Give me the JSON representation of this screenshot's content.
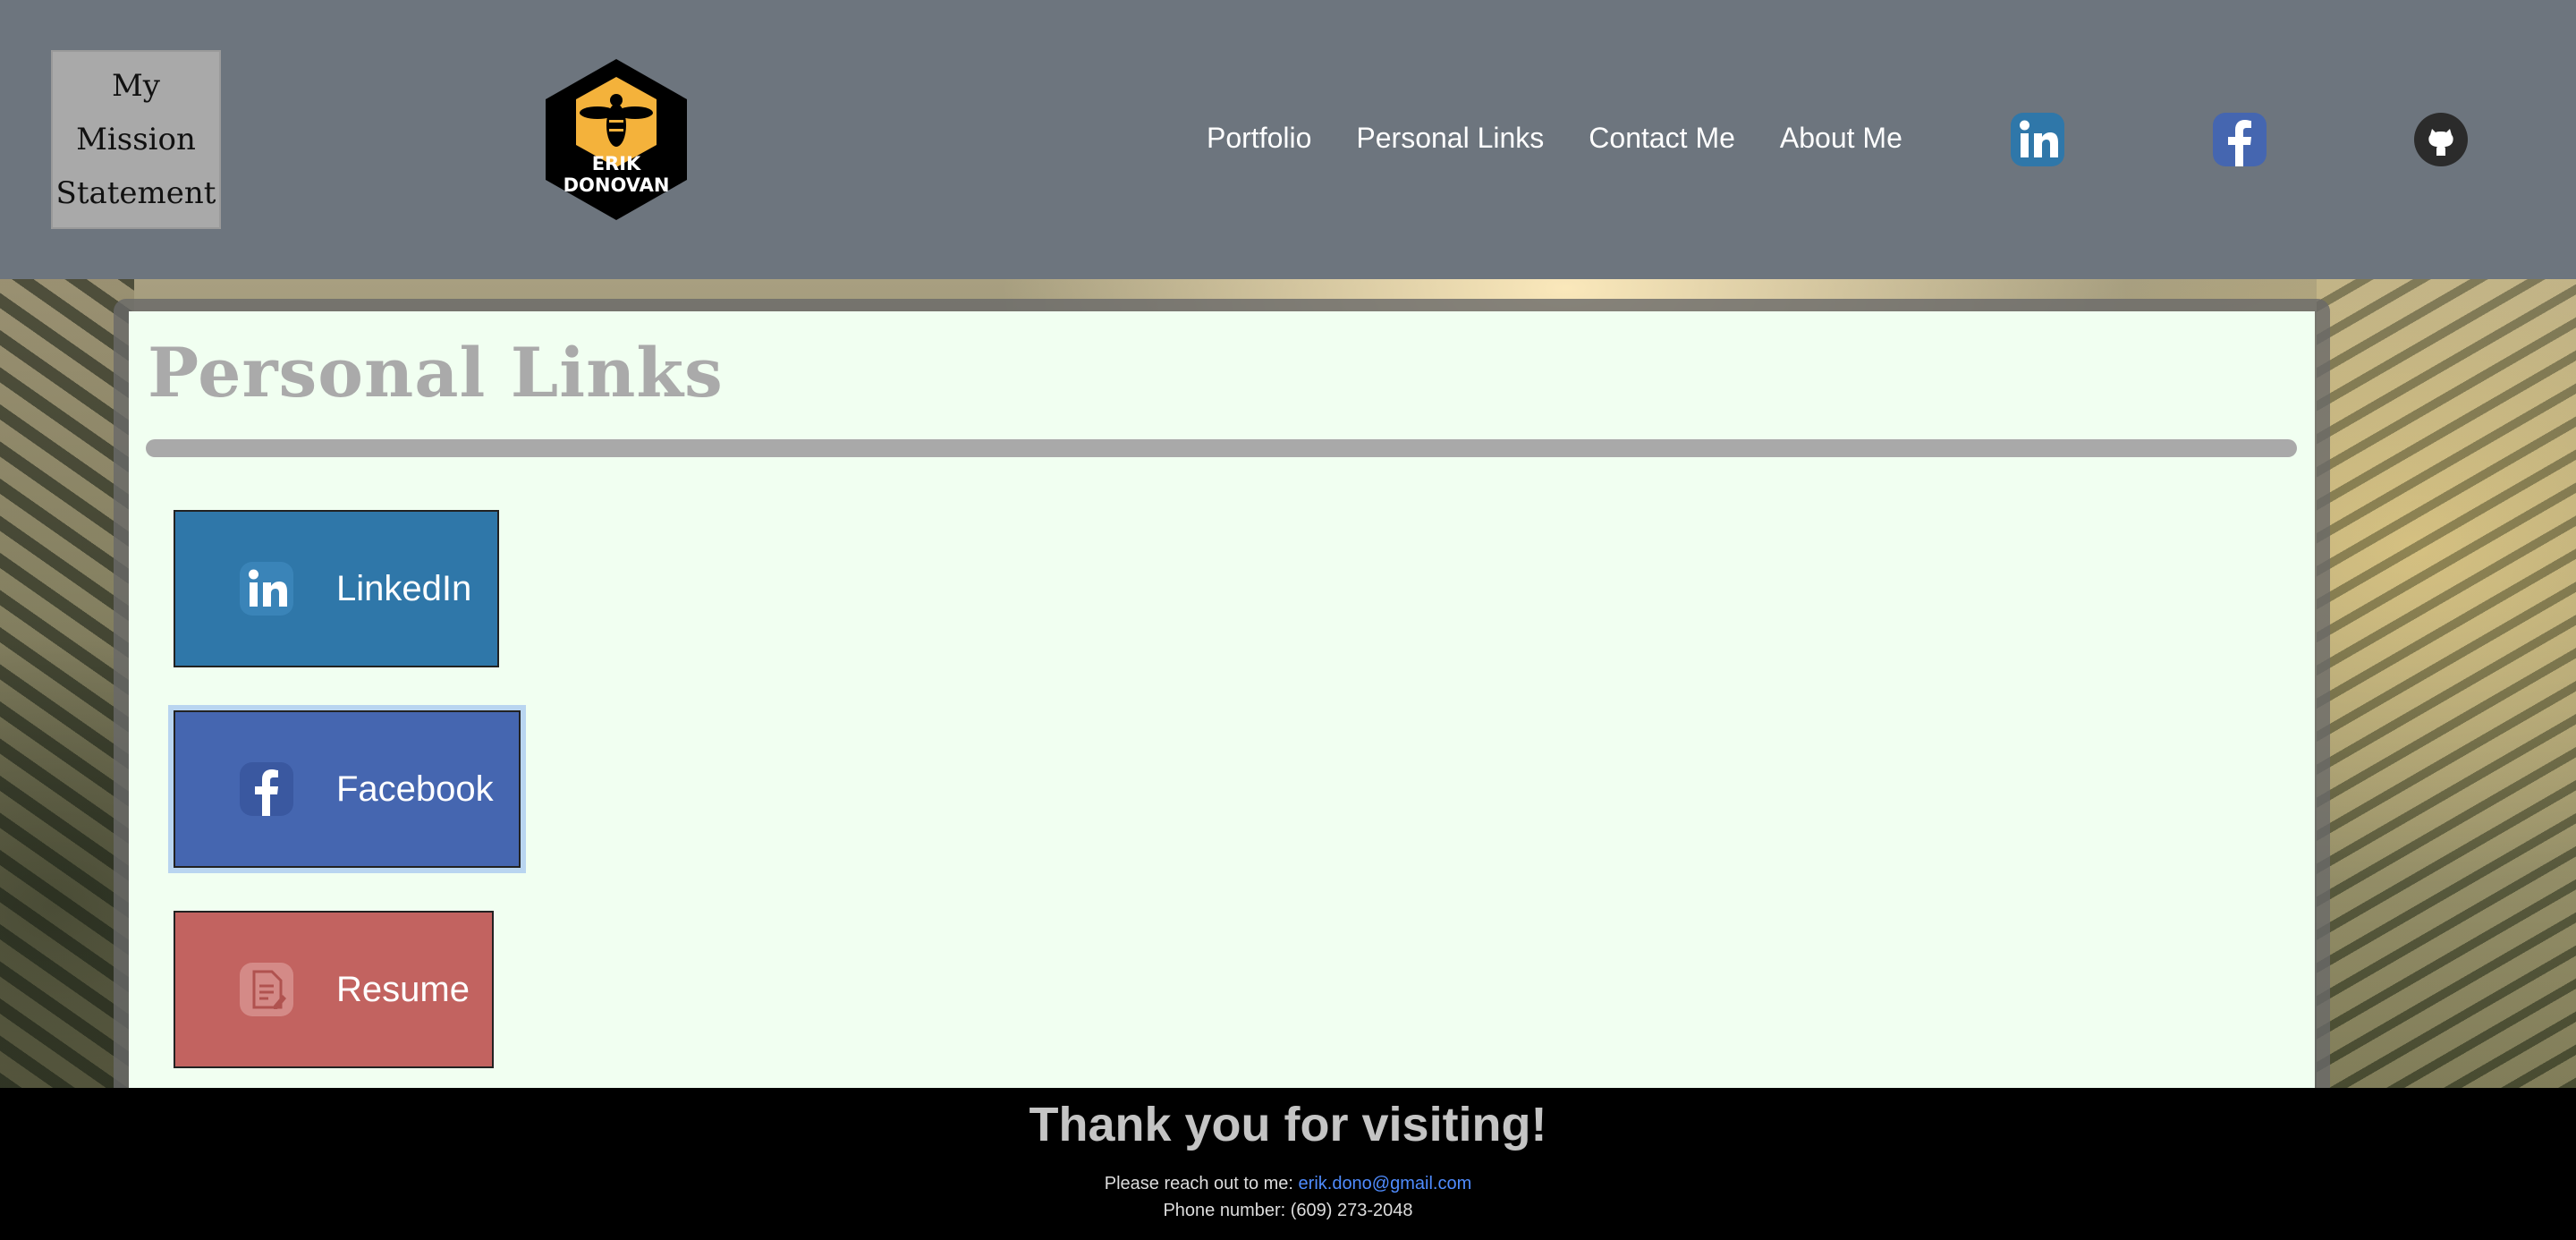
{
  "header": {
    "mission_lines": [
      "My",
      "Mission",
      "Statement"
    ],
    "logo_text": [
      "ERIK",
      "DONOVAN"
    ],
    "nav": [
      {
        "label": "Portfolio"
      },
      {
        "label": "Personal Links"
      },
      {
        "label": "Contact Me"
      },
      {
        "label": "About Me"
      }
    ],
    "social_icons": [
      "linkedin-icon",
      "facebook-icon",
      "github-icon"
    ]
  },
  "main": {
    "title": "Personal Links",
    "buttons": [
      {
        "label": "LinkedIn",
        "icon": "linkedin-icon",
        "color": "#2f77a9"
      },
      {
        "label": "Facebook",
        "icon": "facebook-icon",
        "color": "#4566b0"
      },
      {
        "label": "Resume",
        "icon": "resume-icon",
        "color": "#c26360"
      }
    ]
  },
  "footer": {
    "heading": "Thank you for visiting!",
    "contact_prefix": "Please reach out to me: ",
    "email": "erik.dono@gmail.com",
    "phone": "Phone number: (609) 273-2048"
  },
  "colors": {
    "header_bg": "#6d757e",
    "card_bg": "#f1fff1",
    "footer_bg": "#000000",
    "link_color": "#4f8cff"
  }
}
